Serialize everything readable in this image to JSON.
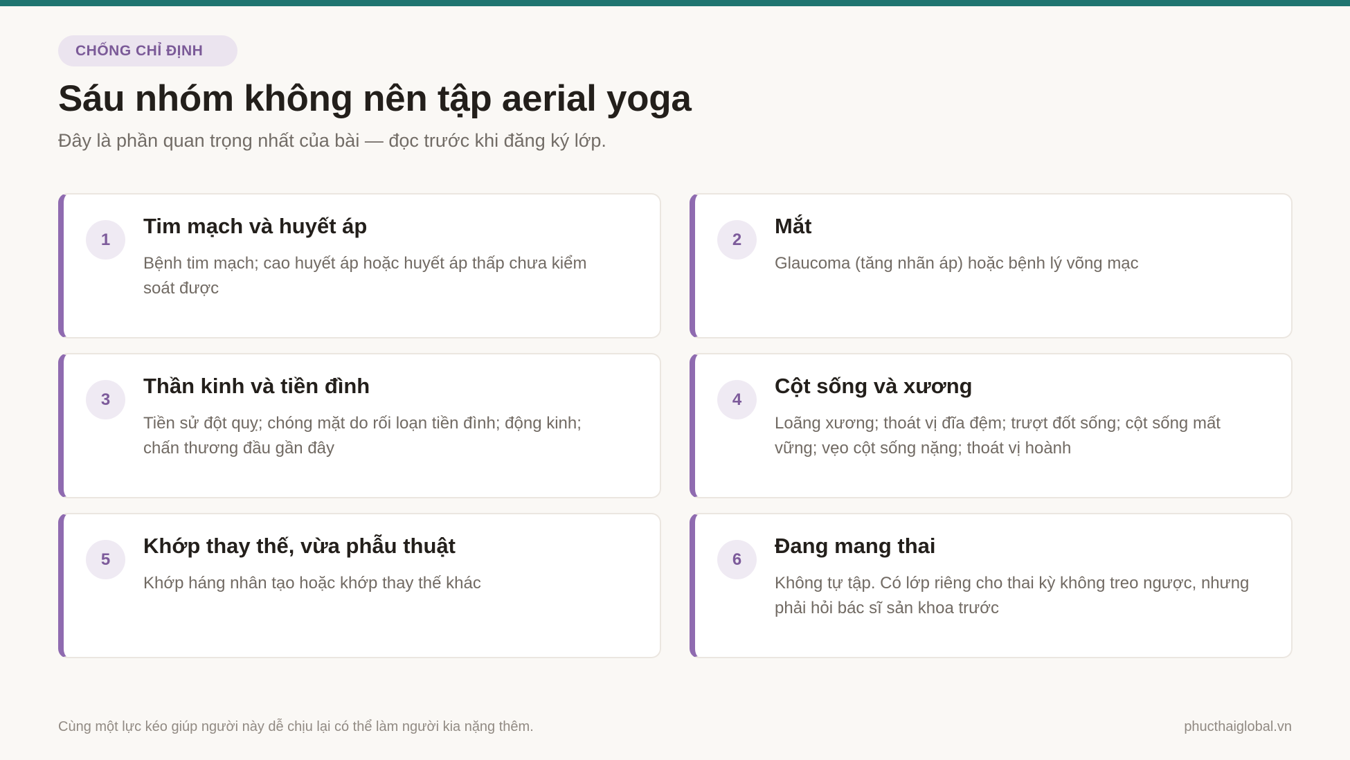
{
  "header": {
    "tag": "CHỐNG CHỈ ĐỊNH",
    "title": "Sáu nhóm không nên tập aerial yoga",
    "subtitle": "Đây là phần quan trọng nhất của bài — đọc trước khi đăng ký lớp."
  },
  "cards": [
    {
      "number": "1",
      "title": "Tim mạch và huyết áp",
      "description": "Bệnh tim mạch; cao huyết áp hoặc huyết áp thấp chưa kiểm soát được"
    },
    {
      "number": "2",
      "title": "Mắt",
      "description": "Glaucoma (tăng nhãn áp) hoặc bệnh lý võng mạc"
    },
    {
      "number": "3",
      "title": "Thần kinh và tiền đình",
      "description": "Tiền sử đột quỵ; chóng mặt do rối loạn tiền đình; động kinh; chấn thương đầu gần đây"
    },
    {
      "number": "4",
      "title": "Cột sống và xương",
      "description": "Loãng xương; thoát vị đĩa đệm; trượt đốt sống; cột sống mất vững; vẹo cột sống nặng; thoát vị hoành"
    },
    {
      "number": "5",
      "title": "Khớp thay thế, vừa phẫu thuật",
      "description": "Khớp háng nhân tạo hoặc khớp thay thế khác"
    },
    {
      "number": "6",
      "title": "Đang mang thai",
      "description": "Không tự tập. Có lớp riêng cho thai kỳ không treo ngược, nhưng phải hỏi bác sĩ sản khoa trước"
    }
  ],
  "footer": {
    "note": "Cùng một lực kéo giúp người này dễ chịu lại có thể làm người kia nặng thêm.",
    "site": "phucthaiglobal.vn"
  },
  "colors": {
    "top_bar": "#1f7570",
    "accent": "#8f6bb0",
    "background": "#faf8f5"
  }
}
